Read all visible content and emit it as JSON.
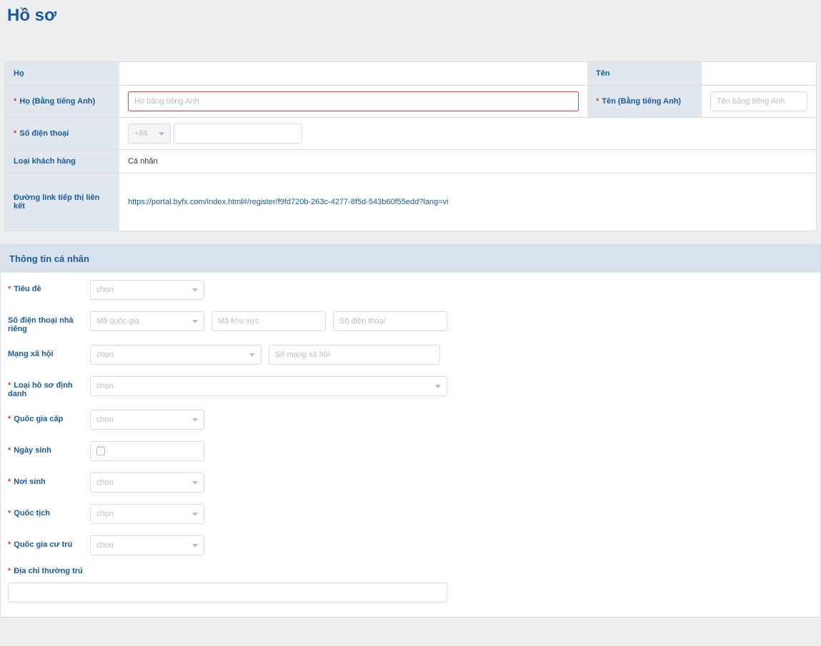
{
  "pageTitle": "Hồ sơ",
  "table": {
    "ho_label": "Họ",
    "ten_label": "Tên",
    "ho_en_label": "Họ (Bằng tiếng Anh)",
    "ho_en_placeholder": "Họ bằng tiếng Anh",
    "ten_en_label": "Tên (Bằng tiếng Anh)",
    "ten_en_placeholder": "Tên bằng tiếng Anh",
    "phone_label": "Số điện thoại",
    "phone_code": "+84",
    "customer_type_label": "Loại khách hàng",
    "customer_type_value": "Cá nhân",
    "affiliate_label": "Đường link tiếp thị liên kết",
    "affiliate_link": "https://portal.byfx.com/index.html#/register/f9fd720b-263c-4277-8f5d-543b60f55edd?lang=vi"
  },
  "personal": {
    "section_title": "Thông tin cá nhân",
    "title_label": "Tiêu đề",
    "choose": "chọn",
    "home_phone_label": "Số điện thoại nhà riêng",
    "country_code_ph": "Mã quốc gia",
    "area_code_ph": "Mã khu vực",
    "phone_ph": "Số điện thoại",
    "social_label": "Mạng xã hội",
    "social_number_ph": "Số mạng xã hội",
    "id_type_label": "Loại hồ sơ định danh",
    "issuing_country_label": "Quốc gia cấp",
    "dob_label": "Ngày sinh",
    "pob_label": "Nơi sinh",
    "nationality_label": "Quốc tịch",
    "residence_label": "Quốc gia cư trú",
    "perm_address_label": "Địa chỉ thường trú"
  }
}
